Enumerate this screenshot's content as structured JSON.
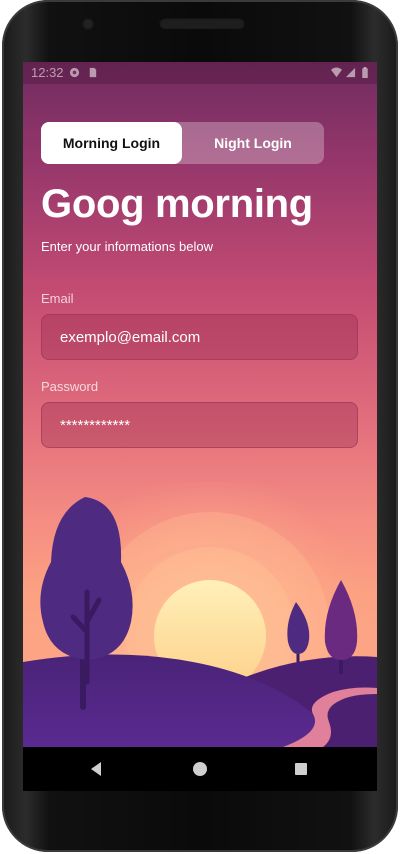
{
  "status_bar": {
    "time": "12:32",
    "left_icons": [
      "settings-gear-icon",
      "sim-card-icon"
    ],
    "right_icons": [
      "wifi-icon",
      "cell-signal-icon",
      "battery-icon"
    ]
  },
  "login_toggle": {
    "morning_label": "Morning Login",
    "night_label": "Night Login",
    "selected": "morning"
  },
  "heading": "Goog morning",
  "subheading": "Enter your informations below",
  "email": {
    "label": "Email",
    "value": "exemplo@email.com"
  },
  "password": {
    "label": "Password",
    "value": "************"
  },
  "nav_bar": {
    "icons": [
      "back-icon",
      "home-icon",
      "recents-icon"
    ]
  },
  "colors": {
    "gradient_top": "#6f2c60",
    "gradient_mid": "#e16d7c",
    "gradient_bottom": "#fda888",
    "hill_purple": "#4a2378",
    "sun": "#fde2a0"
  }
}
